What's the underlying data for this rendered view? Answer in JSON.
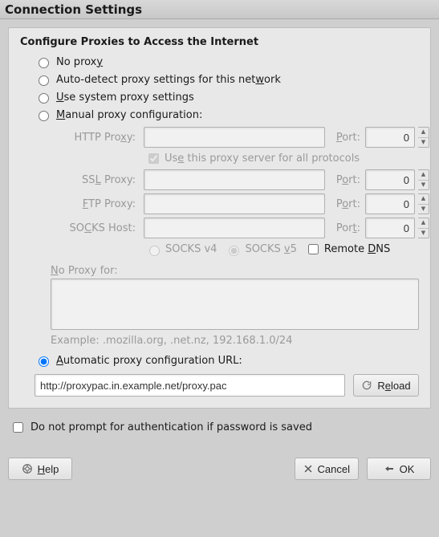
{
  "title": "Connection Settings",
  "group_title": "Configure Proxies to Access the Internet",
  "radios": {
    "no_proxy": {
      "pre": "No prox",
      "u": "y",
      "post": ""
    },
    "auto_detect": {
      "pre": "Auto-detect proxy settings for this net",
      "u": "w",
      "post": "ork"
    },
    "system": {
      "pre": "",
      "u": "U",
      "post": "se system proxy settings"
    },
    "manual": {
      "pre": "",
      "u": "M",
      "post": "anual proxy configuration:"
    },
    "pac": {
      "pre": "",
      "u": "A",
      "post": "utomatic proxy configuration URL:"
    }
  },
  "proxy": {
    "http_label": {
      "pre": "HTTP Pro",
      "u": "x",
      "post": "y:"
    },
    "ssl_label": {
      "pre": "SS",
      "u": "L",
      "post": " Proxy:"
    },
    "ftp_label": {
      "pre": "",
      "u": "F",
      "post": "TP Proxy:"
    },
    "socks_label": {
      "pre": "SO",
      "u": "C",
      "post": "KS Host:"
    },
    "port_http": {
      "pre": "",
      "u": "P",
      "post": "ort:"
    },
    "port_generic": {
      "pre": "P",
      "u": "o",
      "post": "rt:"
    },
    "port_socks": {
      "pre": "Por",
      "u": "t",
      "post": ":"
    },
    "http_value": "",
    "http_port": "0",
    "ssl_value": "",
    "ssl_port": "0",
    "ftp_value": "",
    "ftp_port": "0",
    "socks_value": "",
    "socks_port": "0",
    "use_for_all": {
      "pre": "Us",
      "u": "e",
      "post": " this proxy server for all protocols"
    },
    "socks_v4": "SOCKS v4",
    "socks_v5": {
      "pre": "SOCKS ",
      "u": "v",
      "post": "5"
    },
    "remote_dns": {
      "pre": "Remote ",
      "u": "D",
      "post": "NS"
    },
    "no_proxy_for_label": {
      "pre": "",
      "u": "N",
      "post": "o Proxy for:"
    },
    "no_proxy_value": "",
    "example": "Example: .mozilla.org, .net.nz, 192.168.1.0/24"
  },
  "pac": {
    "url": "http://proxypac.in.example.net/proxy.pac",
    "reload": {
      "pre": "R",
      "u": "e",
      "post": "load"
    }
  },
  "do_not_prompt": "Do not prompt for authentication if password is saved",
  "buttons": {
    "help": {
      "pre": "",
      "u": "H",
      "post": "elp"
    },
    "cancel": "Cancel",
    "ok": "OK"
  }
}
